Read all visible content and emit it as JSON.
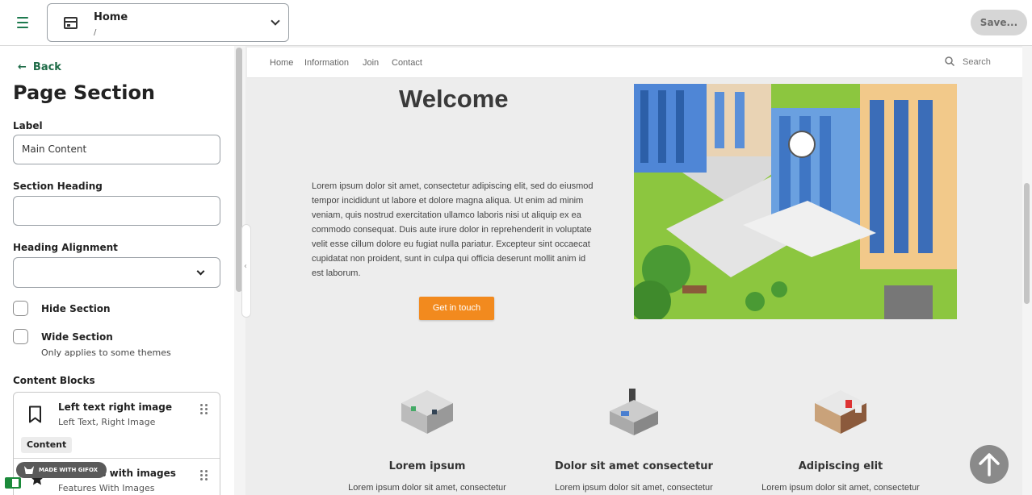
{
  "topbar": {
    "page_title": "Home",
    "page_path": "/",
    "save_label": "Save..."
  },
  "panel": {
    "back_label": "Back",
    "title": "Page Section",
    "label_field": {
      "label": "Label",
      "value": "Main Content"
    },
    "heading_field": {
      "label": "Section Heading",
      "value": ""
    },
    "alignment_field": {
      "label": "Heading Alignment",
      "value": ""
    },
    "hide_section": {
      "label": "Hide Section",
      "checked": false
    },
    "wide_section": {
      "label": "Wide Section",
      "hint": "Only applies to some themes",
      "checked": false
    },
    "content_blocks_label": "Content Blocks",
    "blocks": [
      {
        "title": "Left text right image",
        "subtitle": "Left Text, Right Image",
        "tag": "Content"
      },
      {
        "title": "Features with images",
        "subtitle": "Features With Images"
      }
    ]
  },
  "watermark": {
    "text": "MADE WITH GIFOX"
  },
  "preview": {
    "nav": [
      "Home",
      "Information",
      "Join",
      "Contact"
    ],
    "search_label": "Search",
    "heading": "Welcome",
    "body": "Lorem ipsum dolor sit amet, consectetur adipiscing elit, sed do eiusmod tempor incididunt ut labore et dolore magna aliqua. Ut enim ad minim veniam, quis nostrud exercitation ullamco laboris nisi ut aliquip ex ea commodo consequat. Duis aute irure dolor in reprehenderit in voluptate velit esse cillum dolore eu fugiat nulla pariatur. Excepteur sint occaecat cupidatat non proident, sunt in culpa qui officia deserunt mollit anim id est laborum.",
    "cta_label": "Get in touch",
    "features": [
      {
        "title": "Lorem ipsum",
        "text": "Lorem ipsum dolor sit amet, consectetur"
      },
      {
        "title": "Dolor sit amet consectetur",
        "text": "Lorem ipsum dolor sit amet, consectetur"
      },
      {
        "title": "Adipiscing elit",
        "text": "Lorem ipsum dolor sit amet, consectetur"
      }
    ]
  },
  "colors": {
    "accent_green": "#1e6b47",
    "cta_orange": "#f28a1e",
    "save_disabled": "#d6d6d6"
  }
}
